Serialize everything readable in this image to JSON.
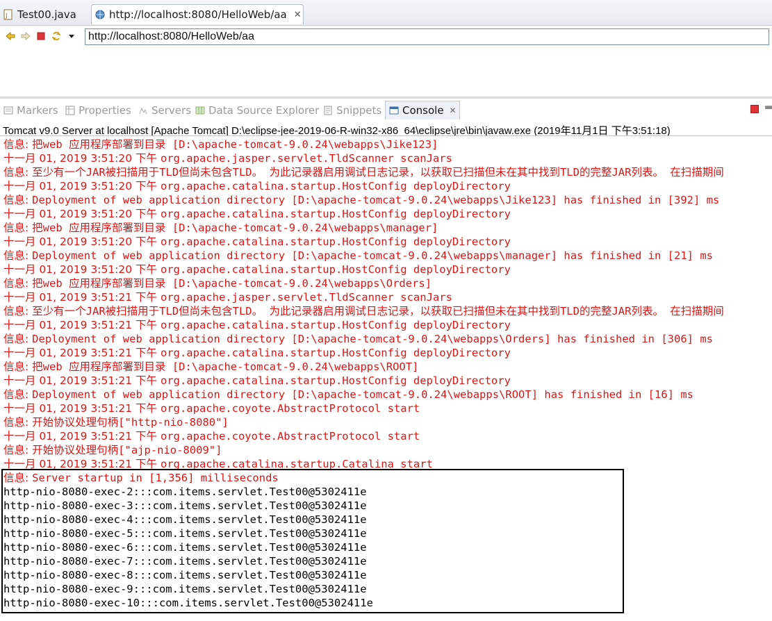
{
  "editor_tabs": [
    {
      "label": "Test00.java",
      "icon": "java-file-icon"
    },
    {
      "label": "http://localhost:8080/HelloWeb/aa",
      "icon": "globe-icon",
      "close": "✕"
    }
  ],
  "browser": {
    "url": "http://localhost:8080/HelloWeb/aa"
  },
  "view_tabs": [
    {
      "label": "Markers",
      "icon": "markers-icon"
    },
    {
      "label": "Properties",
      "icon": "properties-icon"
    },
    {
      "label": "Servers",
      "icon": "servers-icon"
    },
    {
      "label": "Data Source Explorer",
      "icon": "data-source-icon"
    },
    {
      "label": "Snippets",
      "icon": "snippets-icon"
    },
    {
      "label": "Console",
      "icon": "console-icon",
      "close": "✕"
    }
  ],
  "console": {
    "title": "Tomcat v9.0 Server at localhost [Apache Tomcat] D:\\eclipse-jee-2019-06-R-win32-x86_64\\eclipse\\jre\\bin\\javaw.exe (2019年11月1日 下午3:51:18)",
    "lines": [
      {
        "p": "信息: ",
        "t": "把web 应用程序部署到目录 [D:\\apache-tomcat-9.0.24\\webapps\\Jike123]",
        "c": "red"
      },
      {
        "p": "十一月 01, 2019 3:51:20 下午 ",
        "t": "org.apache.jasper.servlet.TldScanner scanJars",
        "c": "red"
      },
      {
        "p": "信息: ",
        "t": "至少有一个JAR被扫描用于TLD但尚未包含TLD。 为此记录器启用调试日志记录，以获取已扫描但未在其中找到TLD的完整JAR列表。 在扫描期间",
        "c": "red"
      },
      {
        "p": "十一月 01, 2019 3:51:20 下午 ",
        "t": "org.apache.catalina.startup.HostConfig deployDirectory",
        "c": "red"
      },
      {
        "p": "信息: ",
        "t": "Deployment of web application directory [D:\\apache-tomcat-9.0.24\\webapps\\Jike123] has finished in [392] ms",
        "c": "red"
      },
      {
        "p": "十一月 01, 2019 3:51:20 下午 ",
        "t": "org.apache.catalina.startup.HostConfig deployDirectory",
        "c": "red"
      },
      {
        "p": "信息: ",
        "t": "把web 应用程序部署到目录 [D:\\apache-tomcat-9.0.24\\webapps\\manager]",
        "c": "red"
      },
      {
        "p": "十一月 01, 2019 3:51:20 下午 ",
        "t": "org.apache.catalina.startup.HostConfig deployDirectory",
        "c": "red"
      },
      {
        "p": "信息: ",
        "t": "Deployment of web application directory [D:\\apache-tomcat-9.0.24\\webapps\\manager] has finished in [21] ms",
        "c": "red"
      },
      {
        "p": "十一月 01, 2019 3:51:20 下午 ",
        "t": "org.apache.catalina.startup.HostConfig deployDirectory",
        "c": "red"
      },
      {
        "p": "信息: ",
        "t": "把web 应用程序部署到目录 [D:\\apache-tomcat-9.0.24\\webapps\\Orders]",
        "c": "red"
      },
      {
        "p": "十一月 01, 2019 3:51:21 下午 ",
        "t": "org.apache.jasper.servlet.TldScanner scanJars",
        "c": "red"
      },
      {
        "p": "信息: ",
        "t": "至少有一个JAR被扫描用于TLD但尚未包含TLD。 为此记录器启用调试日志记录，以获取已扫描但未在其中找到TLD的完整JAR列表。 在扫描期间",
        "c": "red"
      },
      {
        "p": "十一月 01, 2019 3:51:21 下午 ",
        "t": "org.apache.catalina.startup.HostConfig deployDirectory",
        "c": "red"
      },
      {
        "p": "信息: ",
        "t": "Deployment of web application directory [D:\\apache-tomcat-9.0.24\\webapps\\Orders] has finished in [306] ms",
        "c": "red"
      },
      {
        "p": "十一月 01, 2019 3:51:21 下午 ",
        "t": "org.apache.catalina.startup.HostConfig deployDirectory",
        "c": "red"
      },
      {
        "p": "信息: ",
        "t": "把web 应用程序部署到目录 [D:\\apache-tomcat-9.0.24\\webapps\\ROOT]",
        "c": "red"
      },
      {
        "p": "十一月 01, 2019 3:51:21 下午 ",
        "t": "org.apache.catalina.startup.HostConfig deployDirectory",
        "c": "red"
      },
      {
        "p": "信息: ",
        "t": "Deployment of web application directory [D:\\apache-tomcat-9.0.24\\webapps\\ROOT] has finished in [16] ms",
        "c": "red"
      },
      {
        "p": "十一月 01, 2019 3:51:21 下午 ",
        "t": "org.apache.coyote.AbstractProtocol start",
        "c": "red"
      },
      {
        "p": "信息: ",
        "t": "开始协议处理句柄[\"http-nio-8080\"]",
        "c": "red"
      },
      {
        "p": "十一月 01, 2019 3:51:21 下午 ",
        "t": "org.apache.coyote.AbstractProtocol start",
        "c": "red"
      },
      {
        "p": "信息: ",
        "t": "开始协议处理句柄[\"ajp-nio-8009\"]",
        "c": "red"
      },
      {
        "p": "十一月 01, 2019 3:51:21 下午 ",
        "t": "org.apache.catalina.startup.Catalina start",
        "c": "red"
      },
      {
        "p": "信息: ",
        "t": "Server startup in [1,356] milliseconds",
        "c": "red"
      },
      {
        "p": "",
        "t": "http-nio-8080-exec-2:::com.items.servlet.Test00@5302411e",
        "c": "black"
      },
      {
        "p": "",
        "t": "http-nio-8080-exec-3:::com.items.servlet.Test00@5302411e",
        "c": "black"
      },
      {
        "p": "",
        "t": "http-nio-8080-exec-4:::com.items.servlet.Test00@5302411e",
        "c": "black"
      },
      {
        "p": "",
        "t": "http-nio-8080-exec-5:::com.items.servlet.Test00@5302411e",
        "c": "black"
      },
      {
        "p": "",
        "t": "http-nio-8080-exec-6:::com.items.servlet.Test00@5302411e",
        "c": "black"
      },
      {
        "p": "",
        "t": "http-nio-8080-exec-7:::com.items.servlet.Test00@5302411e",
        "c": "black"
      },
      {
        "p": "",
        "t": "http-nio-8080-exec-8:::com.items.servlet.Test00@5302411e",
        "c": "black"
      },
      {
        "p": "",
        "t": "http-nio-8080-exec-9:::com.items.servlet.Test00@5302411e",
        "c": "black"
      },
      {
        "p": "",
        "t": "http-nio-8080-exec-10:::com.items.servlet.Test00@5302411e",
        "c": "black"
      }
    ]
  },
  "colors": {
    "log_red": "#dc1616",
    "highlight_box": "#000000"
  }
}
